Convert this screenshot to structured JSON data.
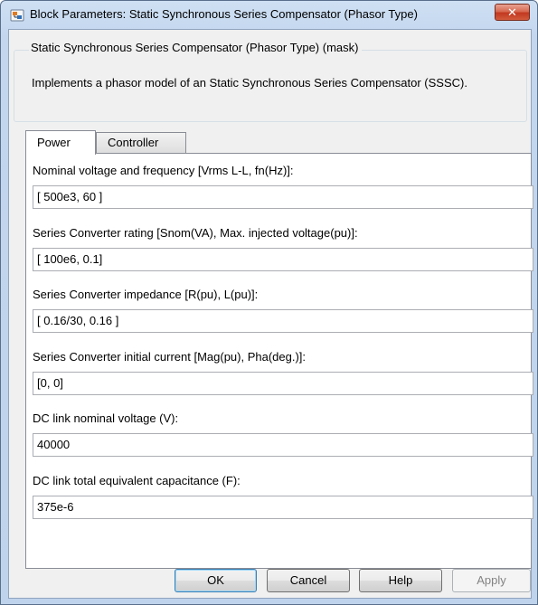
{
  "window": {
    "title": "Block Parameters: Static Synchronous Series Compensator (Phasor Type)",
    "close_glyph": "✕"
  },
  "mask": {
    "legend": "Static Synchronous Series Compensator (Phasor Type) (mask)",
    "description": "Implements a phasor model of an Static Synchronous Series Compensator (SSSC)."
  },
  "tabs": [
    {
      "label": "Power",
      "active": true
    },
    {
      "label": "Controller",
      "active": false
    }
  ],
  "params": [
    {
      "label": "Nominal voltage and frequency [Vrms L-L, fn(Hz)]:",
      "value": "[ 500e3, 60 ]"
    },
    {
      "label": "Series Converter rating [Snom(VA), Max. injected voltage(pu)]:",
      "value": "[ 100e6, 0.1]"
    },
    {
      "label": "Series Converter impedance [R(pu), L(pu)]:",
      "value": "[ 0.16/30, 0.16 ]"
    },
    {
      "label": "Series Converter initial current [Mag(pu), Pha(deg.)]:",
      "value": "[0, 0]"
    },
    {
      "label": "DC link nominal voltage (V):",
      "value": "40000"
    },
    {
      "label": "DC link total equivalent capacitance (F):",
      "value": "375e-6"
    }
  ],
  "buttons": {
    "ok": "OK",
    "cancel": "Cancel",
    "help": "Help",
    "apply": "Apply"
  },
  "icons": {
    "title_icon": "simulink-block-icon",
    "close": "close-icon"
  },
  "colors": {
    "titlebar": "#c3d6ee",
    "close_button": "#c2381f",
    "panel_bg": "#f0f0f0",
    "ok_border": "#3c7fb1"
  }
}
